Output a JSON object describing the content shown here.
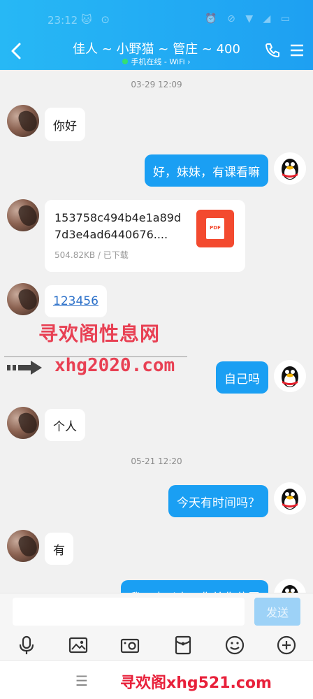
{
  "status_bar": {
    "time": "23:12",
    "left_icons": "🐱 ⊙",
    "right_icons": "⏰ ⊘ ▼ ◢ ▭"
  },
  "header": {
    "title": "佳人 ~ 小野猫 ~ 管庄 ~ 400",
    "subtitle": "手机在线 - WiFi ›"
  },
  "chat": {
    "timestamps": [
      "03-29 12:09",
      "05-21 12:20"
    ],
    "messages": [
      {
        "side": "in",
        "type": "text",
        "text": "你好"
      },
      {
        "side": "out",
        "type": "text",
        "text": "好，妹妹，有课看嘛"
      },
      {
        "side": "in",
        "type": "file",
        "file_name": "153758c494b4e1a89d7d3e4ad6440676....",
        "file_meta": "504.82KB / 已下载",
        "file_icon": "PDF"
      },
      {
        "side": "in",
        "type": "link",
        "text": "123456"
      },
      {
        "side": "out",
        "type": "text",
        "text": "自己吗"
      },
      {
        "side": "in",
        "type": "text",
        "text": "个人"
      },
      {
        "side": "out",
        "type": "text",
        "text": "今天有时间吗？"
      },
      {
        "side": "in",
        "type": "text",
        "text": "有"
      },
      {
        "side": "out",
        "type": "text",
        "text": "我五点以上，你给你位置"
      }
    ]
  },
  "watermark": {
    "line1": "寻欢阁性息网",
    "line2": "xhg2020.com",
    "bottom": "寻欢阁xhg521.com"
  },
  "input": {
    "placeholder": "",
    "send_label": "发送"
  },
  "toolbar": [
    "mic-icon",
    "image-icon",
    "camera-icon",
    "red-packet-icon",
    "emoji-icon",
    "plus-icon"
  ],
  "colors": {
    "header": "#1ea0f2",
    "bubble_out": "#1a9ff3",
    "bubble_in": "#ffffff",
    "background": "#f1f1f1",
    "send_disabled": "#9dd2f7",
    "link": "#2b70c9",
    "watermark": "#e8203a"
  }
}
